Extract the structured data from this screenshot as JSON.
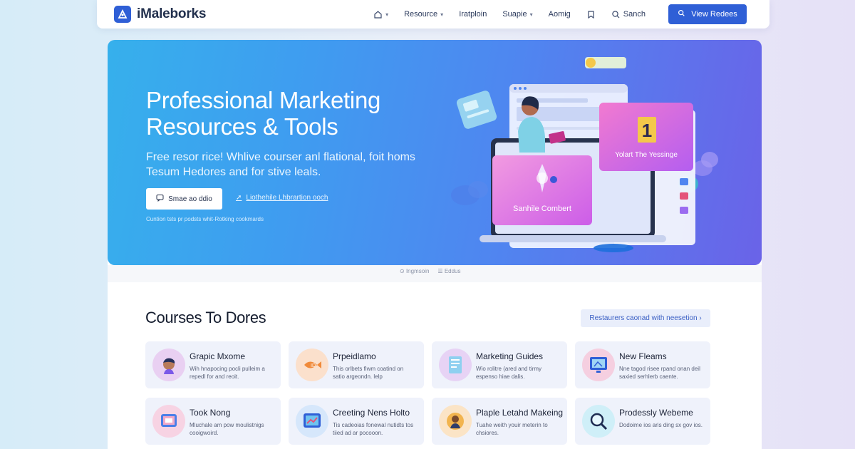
{
  "brand": {
    "name": "iMaleborks"
  },
  "nav": {
    "items": [
      {
        "label": "",
        "icon": "home-icon"
      },
      {
        "label": "Resource"
      },
      {
        "label": "Iratploin"
      },
      {
        "label": "Suapie"
      },
      {
        "label": "Aomig"
      },
      {
        "label": "",
        "icon": "bookmark-icon"
      },
      {
        "label": "Sanch",
        "icon": "search-icon"
      }
    ],
    "cta_label": "View Redees"
  },
  "hero": {
    "title": "Professional Marketing Resources & Tools",
    "subtitle": "Free resor rice! Whlive courser anl flational, foit homs Tesum Hedores and for stive leals.",
    "button_label": "Smae ao ddio",
    "link_label": "Liothehile Lhbrartion ooch",
    "note": "Cuntion tsts pr podsts whit-Rotking cookmards",
    "art": {
      "card_right_label": "Yolart The Yessinge",
      "card_left_label": "Sanhile Combert",
      "badge_number": "1"
    }
  },
  "slider_caption": {
    "left": "Ingmsoin",
    "right": "Eddus"
  },
  "section": {
    "title": "Courses To Dores",
    "link_label": "Restaurers caonad with neesetion ›"
  },
  "cards": [
    {
      "title": "Grapic Mxome",
      "desc": "Wih hnapocing pocli pulleim a repedl for and reoit.",
      "icon": "avatar-icon",
      "color": "#e9d0f2"
    },
    {
      "title": "Prpeidlamo",
      "desc": "This orlbets fiwm coatind on satio argeondn. lelp",
      "icon": "fish-icon",
      "color": "#fbe0cc"
    },
    {
      "title": "Marketing Guides",
      "desc": "Wio rolitre (ared and tirmy espenso hiae dalis.",
      "icon": "document-icon",
      "color": "#e7d3f5"
    },
    {
      "title": "New Fleams",
      "desc": "Nne tagod risee rpand onan deil saxied serhlerb caente.",
      "icon": "monitor-icon",
      "color": "#f5cfe0"
    },
    {
      "title": "Took Nong",
      "desc": "Mluchale am pow moulistnigs cooigwoird.",
      "icon": "tablet-icon",
      "color": "#f7d3e3"
    },
    {
      "title": "Creeting Nens Holto",
      "desc": "Tis cadeoias fonewal nutidts tos tiied ad ar pocooon.",
      "icon": "screen-icon",
      "color": "#d6e7fb"
    },
    {
      "title": "Plaple Letahd Makeing",
      "desc": "Tuahe weith youir meterin to chsiores.",
      "icon": "person-icon",
      "color": "#fbe4c6"
    },
    {
      "title": "Prodessly Webeme",
      "desc": "Dodoime ios aris ding sx gov ios.",
      "icon": "magnifier-icon",
      "color": "#cfeff8"
    }
  ]
}
